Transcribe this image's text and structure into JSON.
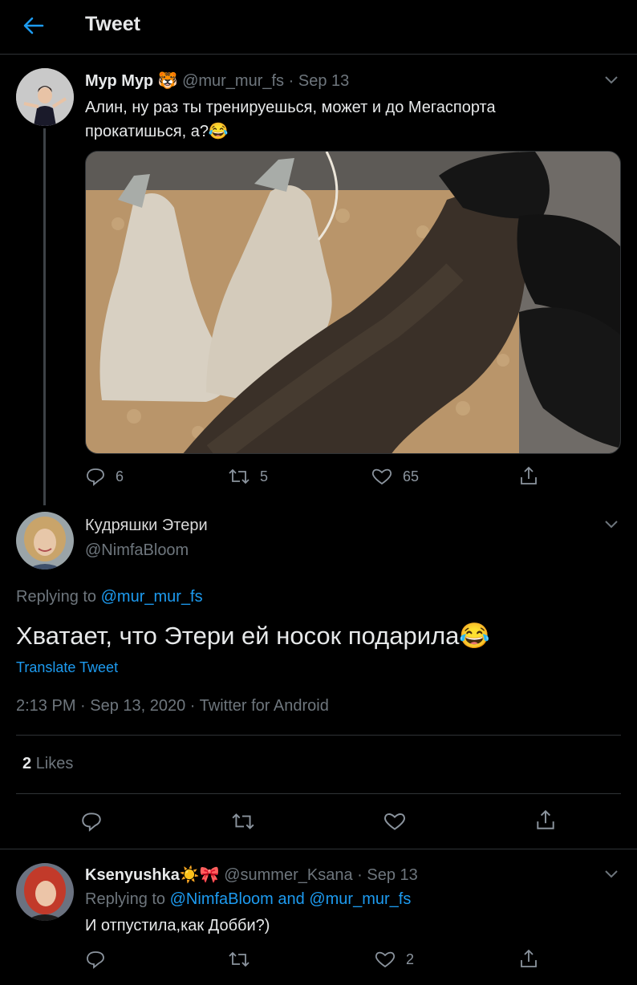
{
  "header": {
    "title": "Tweet"
  },
  "parent_tweet": {
    "name": "Мур Мур",
    "name_emoji": "🐯",
    "handle": "@mur_mur_fs",
    "sep": "·",
    "date": "Sep 13",
    "text": "Алин, ну раз ты тренируешься, может и до Мегаспорта прокатишься, а?😂",
    "replies": "6",
    "retweets": "5",
    "likes": "65"
  },
  "main_tweet": {
    "name": "Кудряшки Этери",
    "handle": "@NimfaBloom",
    "replying_prefix": "Replying to",
    "replying_to": "@mur_mur_fs",
    "text": "Хватает, что Этери ей носок подарила😂",
    "translate": "Translate Tweet",
    "meta": "2:13 PM · Sep 13, 2020 · Twitter for Android",
    "likes_count": "2",
    "likes_label": "Likes"
  },
  "reply_tweet": {
    "name": "Ksenyushka☀️🎀",
    "handle": "@summer_Ksana",
    "sep": "·",
    "date": "Sep 13",
    "replying_prefix": "Replying to",
    "replying_to": "@NimfaBloom and @mur_mur_fs",
    "text": "И отпустила,как Добби?)",
    "likes": "2"
  },
  "colors": {
    "background": "#000000",
    "accent": "#1d9bf0",
    "muted": "#6e767d",
    "text": "#d9d9d9"
  }
}
